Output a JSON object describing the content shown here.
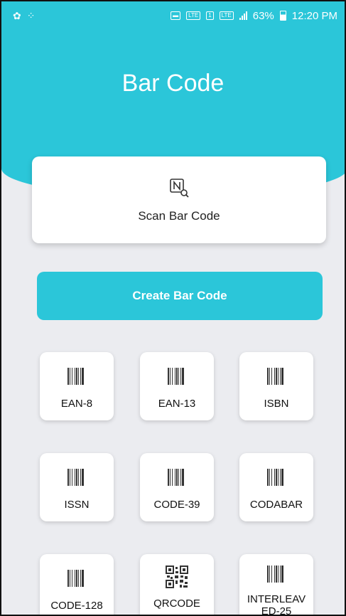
{
  "status_bar": {
    "left_icons": [
      "settings-icon",
      "dots-icon"
    ],
    "right_icons": [
      "cast-icon",
      "volte-icon",
      "sim-icon",
      "lte-icon",
      "signal-icon",
      "battery-icon"
    ],
    "battery": "63%",
    "time": "12:20 PM"
  },
  "header": {
    "title": "Bar Code"
  },
  "scan": {
    "label": "Scan Bar Code",
    "icon": "nfc-search-icon"
  },
  "create": {
    "label": "Create Bar Code"
  },
  "formats": [
    {
      "label": "EAN-8",
      "icon": "barcode-icon"
    },
    {
      "label": "EAN-13",
      "icon": "barcode-icon"
    },
    {
      "label": "ISBN",
      "icon": "barcode-icon"
    },
    {
      "label": "ISSN",
      "icon": "barcode-icon"
    },
    {
      "label": "CODE-39",
      "icon": "barcode-icon"
    },
    {
      "label": "CODABAR",
      "icon": "barcode-icon"
    },
    {
      "label": "CODE-128",
      "icon": "barcode-icon"
    },
    {
      "label": "QRCODE",
      "icon": "qr-code-icon"
    },
    {
      "label": "INTERLEAVED-25",
      "label_line1": "INTERLEAV",
      "label_line2": "ED-25",
      "icon": "barcode-icon"
    }
  ],
  "colors": {
    "accent": "#2bc6d9",
    "background": "#ebecf0",
    "card": "#ffffff"
  }
}
